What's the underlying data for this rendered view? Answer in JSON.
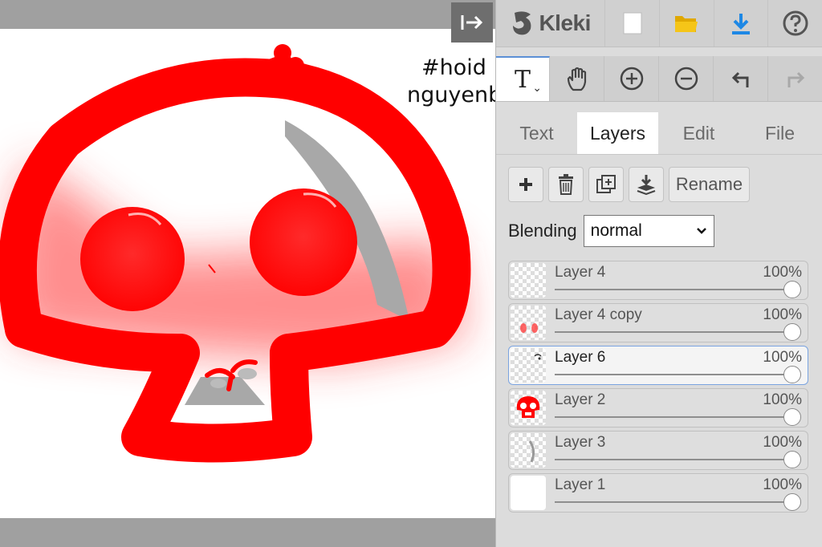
{
  "canvas": {
    "text_line1": "#hoid",
    "text_line2": "nguyenb"
  },
  "header": {
    "logo_text": "Kleki"
  },
  "toolbar_icons": [
    "new-image-icon",
    "open-folder-icon",
    "download-icon",
    "help-icon"
  ],
  "tools": {
    "text_tool_glyph": "T",
    "chevron_glyph": "⌄"
  },
  "tabs": [
    {
      "label": "Text",
      "active": false
    },
    {
      "label": "Layers",
      "active": true
    },
    {
      "label": "Edit",
      "active": false
    },
    {
      "label": "File",
      "active": false
    }
  ],
  "layer_actions": {
    "rename_label": "Rename"
  },
  "blending": {
    "label": "Blending",
    "value": "normal"
  },
  "layers": [
    {
      "name": "Layer 4",
      "opacity": "100%",
      "selected": false
    },
    {
      "name": "Layer 4 copy",
      "opacity": "100%",
      "selected": false
    },
    {
      "name": "Layer 6",
      "opacity": "100%",
      "selected": true
    },
    {
      "name": "Layer 2",
      "opacity": "100%",
      "selected": false
    },
    {
      "name": "Layer 3",
      "opacity": "100%",
      "selected": false
    },
    {
      "name": "Layer 1",
      "opacity": "100%",
      "selected": false
    }
  ],
  "colors": {
    "drawing_red": "#ff0000",
    "accent_blue": "#1e88e5",
    "folder_yellow": "#f5c518"
  }
}
